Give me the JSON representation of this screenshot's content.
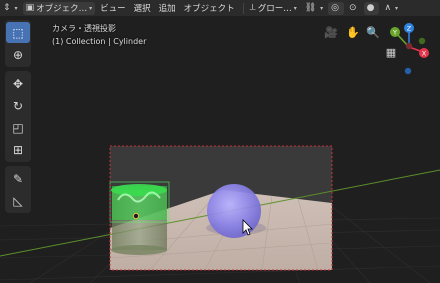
{
  "header": {
    "mode_label": "オブジェク…",
    "menu_view": "ビュー",
    "menu_select": "選択",
    "menu_add": "追加",
    "menu_object": "オブジェクト",
    "orientation_label": "グロー…"
  },
  "viewport_info": {
    "line1": "カメラ・透視投影",
    "line2": "(1) Collection | Cylinder"
  },
  "colors": {
    "header_bg": "#2b2b2b",
    "active_tool": "#4772b3",
    "axis_x": "#e3344b",
    "axis_y": "#6aa52b",
    "axis_z": "#2f83e3",
    "selected_object": "#36e04c",
    "sphere": "#8d84e8"
  },
  "icons": [
    "editor-type-icon",
    "object-mode-icon",
    "viewport-transform-icon",
    "snap-icon",
    "proportional-icon",
    "overlay-icon",
    "shading-solid-icon",
    "camera-icon",
    "hand-icon",
    "zoom-icon",
    "grid-icon",
    "select-box-icon",
    "cursor-icon",
    "move-icon",
    "rotate-icon",
    "scale-icon",
    "transform-icon",
    "annotate-icon",
    "measure-icon"
  ]
}
